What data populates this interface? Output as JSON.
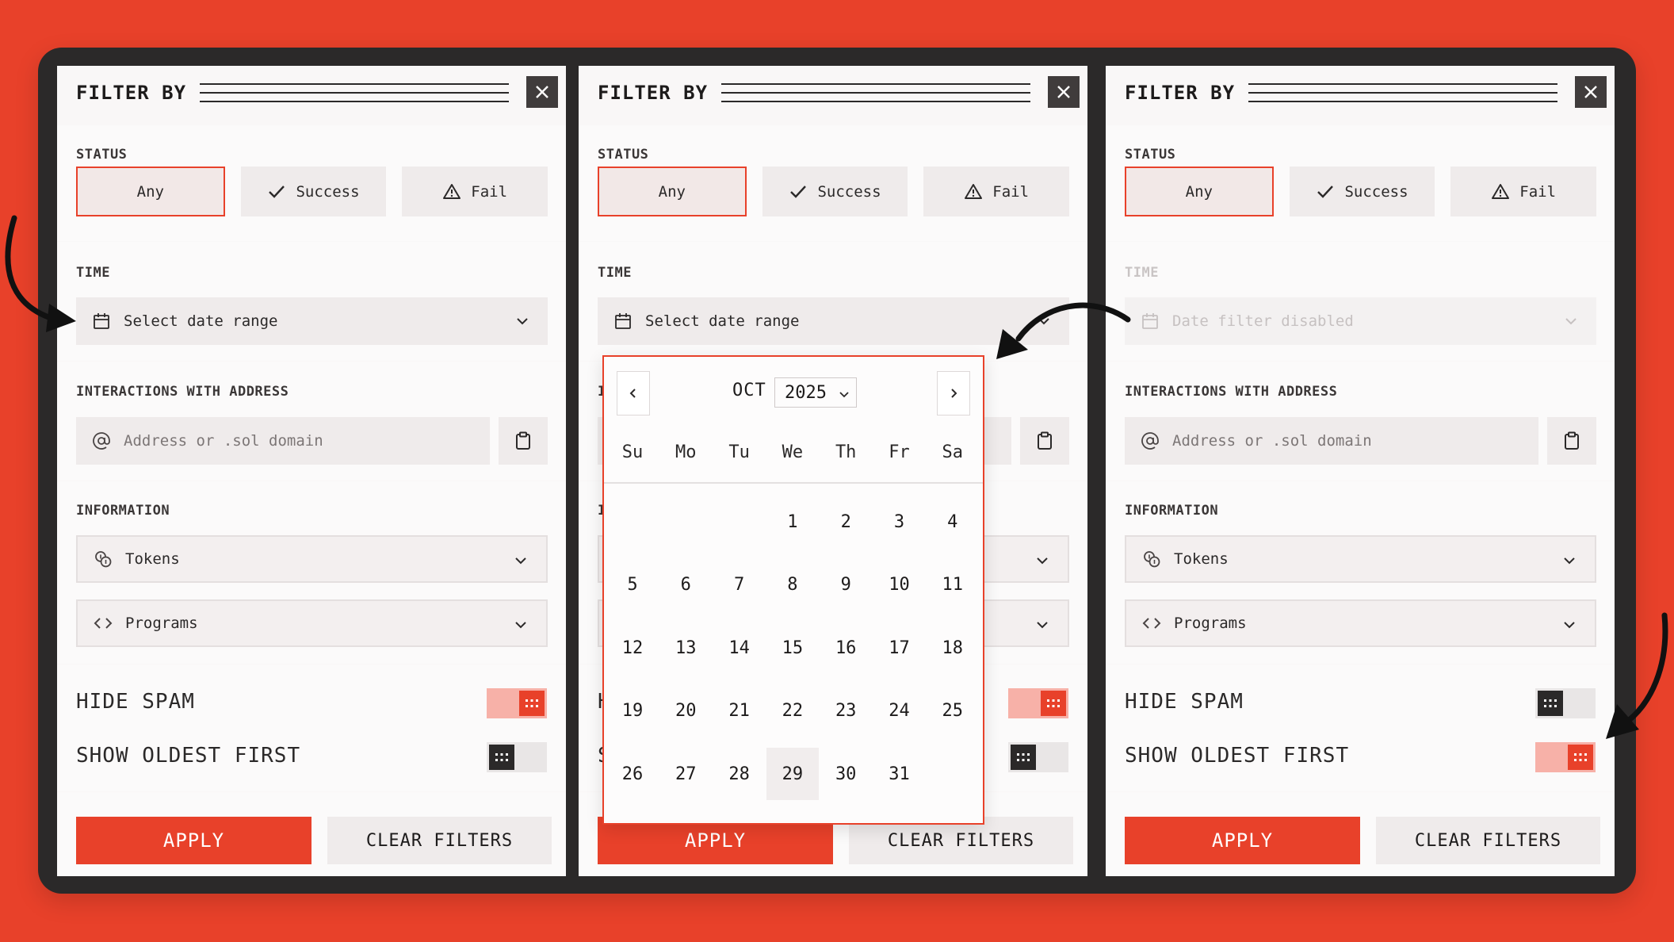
{
  "panel": {
    "title": "FILTER BY",
    "status": {
      "label": "STATUS",
      "options": [
        "Any",
        "Success",
        "Fail"
      ],
      "selected": "Any"
    },
    "time": {
      "label": "TIME",
      "placeholder": "Select date range",
      "disabled_text": "Date filter disabled"
    },
    "address": {
      "label": "INTERACTIONS WITH ADDRESS",
      "placeholder": "Address or .sol domain"
    },
    "information": {
      "label": "INFORMATION",
      "dropdowns": [
        "Tokens",
        "Programs"
      ]
    },
    "toggles": {
      "hide_spam": "HIDE SPAM",
      "show_oldest_first": "SHOW OLDEST FIRST"
    },
    "apply_label": "APPLY",
    "clear_label": "CLEAR FILTERS"
  },
  "states": [
    {
      "hide_spam": true,
      "show_oldest_first": false,
      "time_disabled": false
    },
    {
      "hide_spam": true,
      "show_oldest_first": false,
      "time_disabled": false,
      "calendar_open": true
    },
    {
      "hide_spam": false,
      "show_oldest_first": true,
      "time_disabled": true
    }
  ],
  "calendar": {
    "month": "OCT",
    "year": "2025",
    "weekdays": [
      "Su",
      "Mo",
      "Tu",
      "We",
      "Th",
      "Fr",
      "Sa"
    ],
    "first_weekday_index": 3,
    "days_in_month": 31,
    "highlighted_day": 29
  },
  "colors": {
    "accent": "#e8412a",
    "background": "#e8412a",
    "frame": "#2b2929",
    "panel": "#f9f7f7",
    "control": "#efebeb"
  },
  "icons": {
    "close": "close-icon",
    "success": "check-icon",
    "fail": "warning-icon",
    "calendar": "calendar-icon",
    "chevron": "chevron-down-icon",
    "at": "at-icon",
    "clipboard": "clipboard-icon",
    "tokens": "coins-icon",
    "programs": "code-icon",
    "toggle_knob": "grip-icon"
  }
}
